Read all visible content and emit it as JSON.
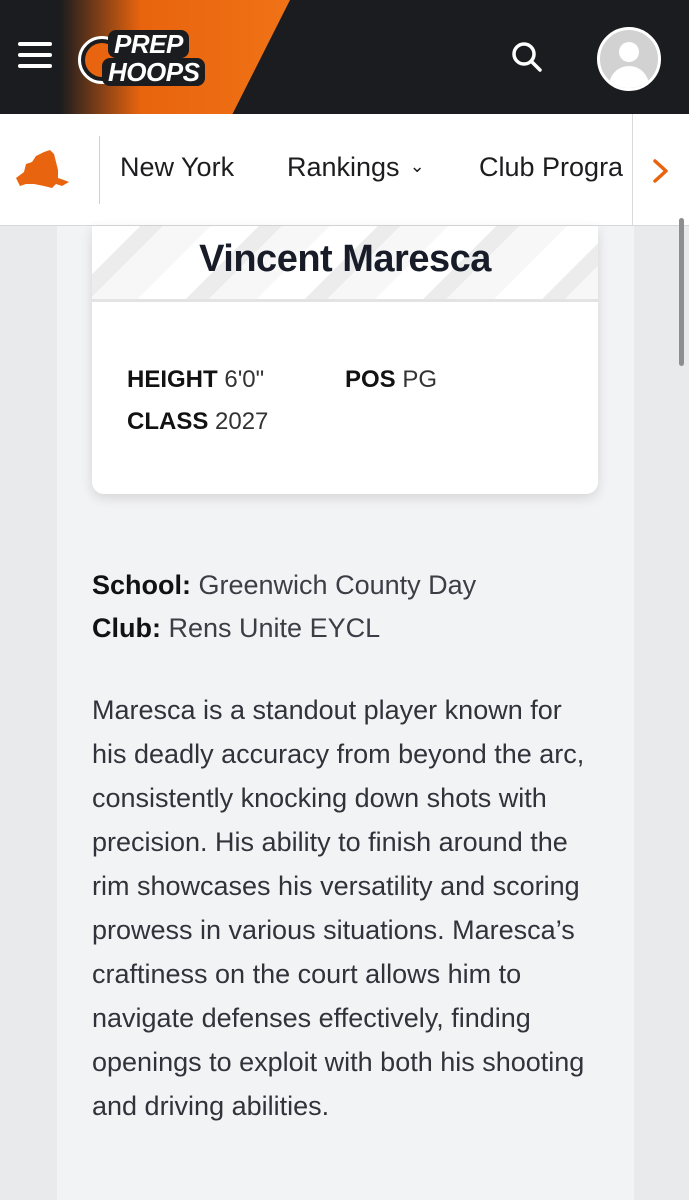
{
  "header": {
    "logo_line1": "PREP",
    "logo_line2": "HOOPS",
    "colors": {
      "background": "#1b1c1f",
      "accent": "#e8640e"
    }
  },
  "nav": {
    "items": [
      {
        "label": "New York"
      },
      {
        "label": "Rankings",
        "dropdown": true
      },
      {
        "label": "Club Progra"
      }
    ]
  },
  "player": {
    "name": "Vincent Maresca",
    "height_label": "HEIGHT",
    "height_value": "6'0\"",
    "pos_label": "POS",
    "pos_value": "PG",
    "class_label": "CLASS",
    "class_value": "2027",
    "school_label": "School:",
    "school_value": "Greenwich County Day",
    "club_label": "Club:",
    "club_value": "Rens Unite EYCL",
    "bio": "Maresca is a standout player known for his deadly accuracy from beyond the arc, consistently knocking down shots with precision. His ability to finish around the rim showcases his versatility and scoring prowess in various situations. Maresca’s craftiness on the court allows him to navigate defenses effectively, finding openings to exploit with both his shooting and driving abilities."
  },
  "icons": [
    "menu-icon",
    "search-icon",
    "user-avatar-icon",
    "new-york-state-icon",
    "chevron-down-icon",
    "chevron-right-icon"
  ]
}
